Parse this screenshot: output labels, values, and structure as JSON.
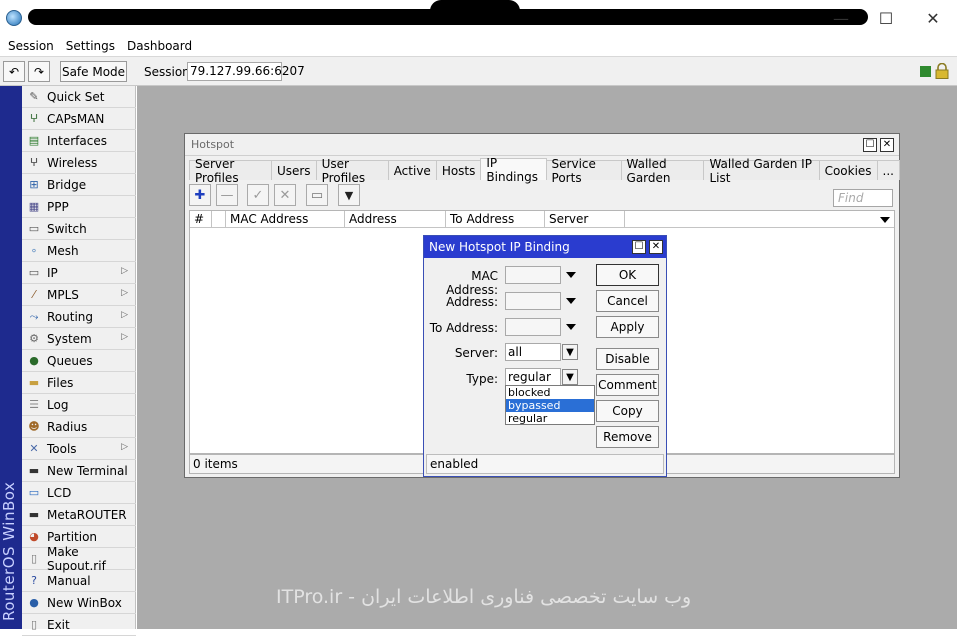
{
  "window": {
    "controls": {
      "minimize": "—",
      "maximize": "☐",
      "close": "✕"
    }
  },
  "menubar": {
    "items": [
      "Session",
      "Settings",
      "Dashboard"
    ]
  },
  "toolbar": {
    "undo": "↶",
    "redo": "↷",
    "safe_mode": "Safe Mode",
    "session_label": "Session:",
    "session_value": "79.127.99.66:6207"
  },
  "branding": {
    "vertical": "RouterOS WinBox"
  },
  "sidebar": {
    "items": [
      {
        "label": "Quick Set",
        "icon": "wand-icon",
        "glyph": "✎",
        "submenu": ""
      },
      {
        "label": "CAPsMAN",
        "icon": "antenna-icon",
        "glyph": "ⵖ",
        "submenu": ""
      },
      {
        "label": "Interfaces",
        "icon": "interfaces-icon",
        "glyph": "▤",
        "submenu": ""
      },
      {
        "label": "Wireless",
        "icon": "wireless-icon",
        "glyph": "ⵖ",
        "submenu": ""
      },
      {
        "label": "Bridge",
        "icon": "bridge-icon",
        "glyph": "⊞",
        "submenu": ""
      },
      {
        "label": "PPP",
        "icon": "ppp-icon",
        "glyph": "▦",
        "submenu": ""
      },
      {
        "label": "Switch",
        "icon": "switch-icon",
        "glyph": "▭",
        "submenu": ""
      },
      {
        "label": "Mesh",
        "icon": "mesh-icon",
        "glyph": "∘",
        "submenu": ""
      },
      {
        "label": "IP",
        "icon": "ip-icon",
        "glyph": "▭",
        "submenu": "▷"
      },
      {
        "label": "MPLS",
        "icon": "mpls-icon",
        "glyph": "⁄",
        "submenu": "▷"
      },
      {
        "label": "Routing",
        "icon": "routing-icon",
        "glyph": "⤳",
        "submenu": "▷"
      },
      {
        "label": "System",
        "icon": "gear-icon",
        "glyph": "⚙",
        "submenu": "▷"
      },
      {
        "label": "Queues",
        "icon": "queues-icon",
        "glyph": "●",
        "submenu": ""
      },
      {
        "label": "Files",
        "icon": "folder-icon",
        "glyph": "▬",
        "submenu": ""
      },
      {
        "label": "Log",
        "icon": "log-icon",
        "glyph": "☰",
        "submenu": ""
      },
      {
        "label": "Radius",
        "icon": "users-icon",
        "glyph": "☻",
        "submenu": ""
      },
      {
        "label": "Tools",
        "icon": "tools-icon",
        "glyph": "✕",
        "submenu": "▷"
      },
      {
        "label": "New Terminal",
        "icon": "terminal-icon",
        "glyph": "▬",
        "submenu": ""
      },
      {
        "label": "LCD",
        "icon": "lcd-icon",
        "glyph": "▭",
        "submenu": ""
      },
      {
        "label": "MetaROUTER",
        "icon": "metarouter-icon",
        "glyph": "▬",
        "submenu": ""
      },
      {
        "label": "Partition",
        "icon": "partition-icon",
        "glyph": "◕",
        "submenu": ""
      },
      {
        "label": "Make Supout.rif",
        "icon": "file-icon",
        "glyph": "▯",
        "submenu": ""
      },
      {
        "label": "Manual",
        "icon": "help-icon",
        "glyph": "?",
        "submenu": ""
      },
      {
        "label": "New WinBox",
        "icon": "winbox-icon",
        "glyph": "●",
        "submenu": ""
      },
      {
        "label": "Exit",
        "icon": "exit-icon",
        "glyph": "▯",
        "submenu": ""
      }
    ]
  },
  "hotspot": {
    "title": "Hotspot",
    "tabs": [
      "Server Profiles",
      "Users",
      "User Profiles",
      "Active",
      "Hosts",
      "IP Bindings",
      "Service Ports",
      "Walled Garden",
      "Walled Garden IP List",
      "Cookies",
      "..."
    ],
    "active_tab": "IP Bindings",
    "find_placeholder": "Find",
    "columns": [
      "#",
      "MAC Address",
      "Address",
      "To Address",
      "Server"
    ],
    "footer": "0 items",
    "tool_glyphs": {
      "add": "✚",
      "remove": "—",
      "enable": "✓",
      "disable": "✕",
      "comment": "▭",
      "filter": "▼"
    }
  },
  "dialog": {
    "title": "New Hotspot IP Binding",
    "fields": {
      "mac_label": "MAC Address:",
      "address_label": "Address:",
      "to_address_label": "To Address:",
      "server_label": "Server:",
      "server_value": "all",
      "type_label": "Type:",
      "type_value": "regular"
    },
    "type_options": [
      "blocked",
      "bypassed",
      "regular"
    ],
    "highlighted_option": "bypassed",
    "buttons": {
      "ok": "OK",
      "cancel": "Cancel",
      "apply": "Apply",
      "disable": "Disable",
      "comment": "Comment",
      "copy": "Copy",
      "remove": "Remove"
    },
    "status": "enabled"
  },
  "watermark": "ITPro.ir - وب سایت تخصصی فناوری اطلاعات ایران",
  "colors": {
    "dialog_title": "#2a3ccf",
    "selection": "#2a6fd6",
    "vertical_band": "#1e2a8e",
    "desktop": "#ababab"
  }
}
